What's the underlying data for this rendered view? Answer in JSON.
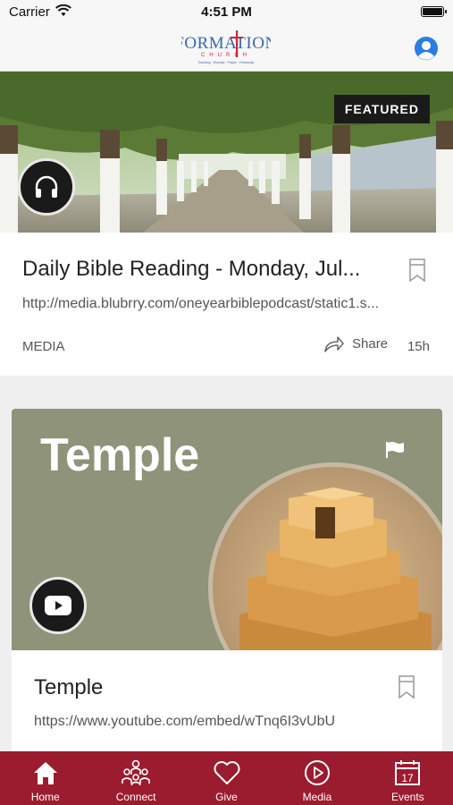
{
  "status_bar": {
    "carrier": "Carrier",
    "time": "4:51 PM"
  },
  "header": {
    "logo_text": "FORMATION",
    "logo_sub": "CHURCH",
    "logo_tagline": "Teaching · Worship · Prayer · Fellowship"
  },
  "featured_card": {
    "badge": "FEATURED",
    "title": "Daily Bible Reading - Monday, Jul...",
    "url": "http://media.blubrry.com/oneyearbiblepodcast/static1.s...",
    "category": "MEDIA",
    "share_label": "Share",
    "age": "15h"
  },
  "video_card": {
    "hero_title": "Temple",
    "title": "Temple",
    "url": "https://www.youtube.com/embed/wTnq6I3vUbU"
  },
  "tabs": [
    {
      "label": "Home",
      "icon": "home-icon"
    },
    {
      "label": "Connect",
      "icon": "people-icon"
    },
    {
      "label": "Give",
      "icon": "heart-icon"
    },
    {
      "label": "Media",
      "icon": "play-icon"
    },
    {
      "label": "Events",
      "icon": "calendar-icon"
    }
  ],
  "colors": {
    "tab_bar": "#9b1b2f",
    "profile_accent": "#2a7de1",
    "temple_bg": "#8e9379",
    "logo_blue": "#3a68b0",
    "logo_red": "#c8283a"
  }
}
